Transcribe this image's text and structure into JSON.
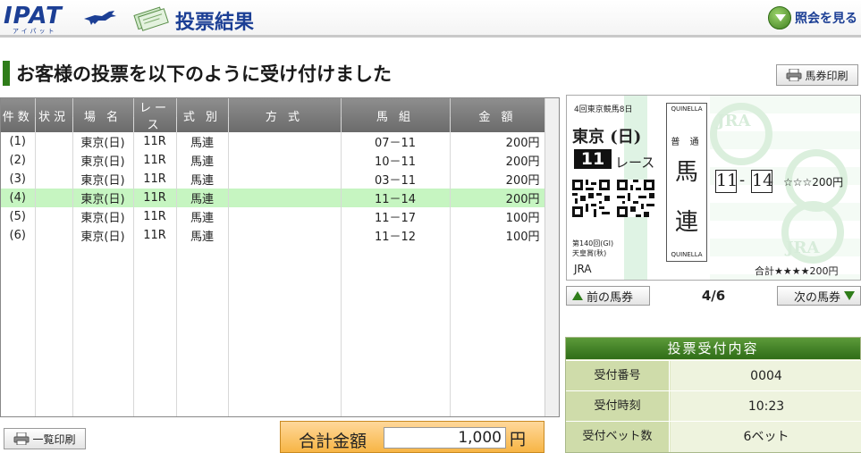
{
  "header": {
    "logo": "IPAT",
    "logo_sub": "アイパット",
    "title": "投票結果",
    "inquiry_label": "照会を見る"
  },
  "heading": "お客様の投票を以下のように受け付けました",
  "ticket_print_label": "馬券印刷",
  "table": {
    "columns": [
      "件数",
      "状況",
      "場 名",
      "レース",
      "式 別",
      "方 式",
      "馬 組",
      "金 額"
    ],
    "rows": [
      {
        "no": "(1)",
        "status": "",
        "venue": "東京(日)",
        "race": "11R",
        "type": "馬連",
        "method": "",
        "combo": "07－11",
        "amount": "200円"
      },
      {
        "no": "(2)",
        "status": "",
        "venue": "東京(日)",
        "race": "11R",
        "type": "馬連",
        "method": "",
        "combo": "10－11",
        "amount": "200円"
      },
      {
        "no": "(3)",
        "status": "",
        "venue": "東京(日)",
        "race": "11R",
        "type": "馬連",
        "method": "",
        "combo": "03－11",
        "amount": "200円"
      },
      {
        "no": "(4)",
        "status": "",
        "venue": "東京(日)",
        "race": "11R",
        "type": "馬連",
        "method": "",
        "combo": "11－14",
        "amount": "200円"
      },
      {
        "no": "(5)",
        "status": "",
        "venue": "東京(日)",
        "race": "11R",
        "type": "馬連",
        "method": "",
        "combo": "11－17",
        "amount": "100円"
      },
      {
        "no": "(6)",
        "status": "",
        "venue": "東京(日)",
        "race": "11R",
        "type": "馬連",
        "method": "",
        "combo": "11－12",
        "amount": "100円"
      }
    ],
    "selected_row": 3
  },
  "list_print_label": "一覧印刷",
  "total": {
    "label": "合計金額",
    "value": "1,000",
    "unit": "円"
  },
  "ticket": {
    "meeting": "4回東京競馬8日",
    "venue": "東京 (日)",
    "race_number": "11",
    "race_label": "レース",
    "race_name_line1": "第140回(GI)",
    "race_name_line2": "天皇賞(秋)",
    "org": "JRA",
    "quinella_text": "QUINELLA",
    "type_sub": "普 通",
    "type_char1": "馬",
    "type_char2": "連",
    "horse1": "11",
    "dash": "-",
    "horse2": "14",
    "amount": "☆☆☆200円",
    "total": "合計★★★★200円",
    "watermark": "JRA"
  },
  "nav": {
    "prev_label": "前の馬券",
    "page": "4/6",
    "next_label": "次の馬券"
  },
  "receipt": {
    "title": "投票受付内容",
    "rows": [
      {
        "label": "受付番号",
        "value": "0004"
      },
      {
        "label": "受付時刻",
        "value": "10:23"
      },
      {
        "label": "受付ベット数",
        "value": "6ベット"
      }
    ]
  },
  "colors": {
    "brand_blue": "#1c3f95",
    "accent_green": "#2f7d1a",
    "selected_row": "#c6f5c1",
    "total_orange": "#f7b545"
  }
}
